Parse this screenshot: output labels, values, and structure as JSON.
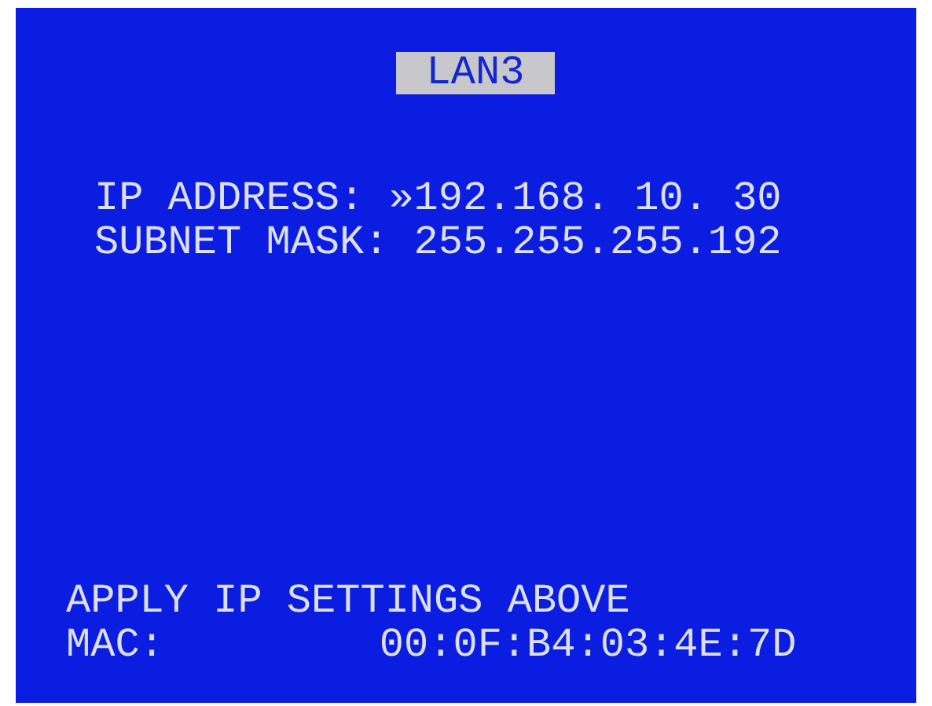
{
  "title": {
    "text": "LAN3"
  },
  "fields": [
    {
      "label": "IP ADDRESS:",
      "value": "»192.168. 10. 30"
    },
    {
      "label": "SUBNET MASK:",
      "value": "255.255.255.192"
    }
  ],
  "apply_action": "APPLY IP SETTINGS ABOVE",
  "mac": {
    "label": "MAC:",
    "value": "00:0F:B4:03:4E:7D"
  }
}
